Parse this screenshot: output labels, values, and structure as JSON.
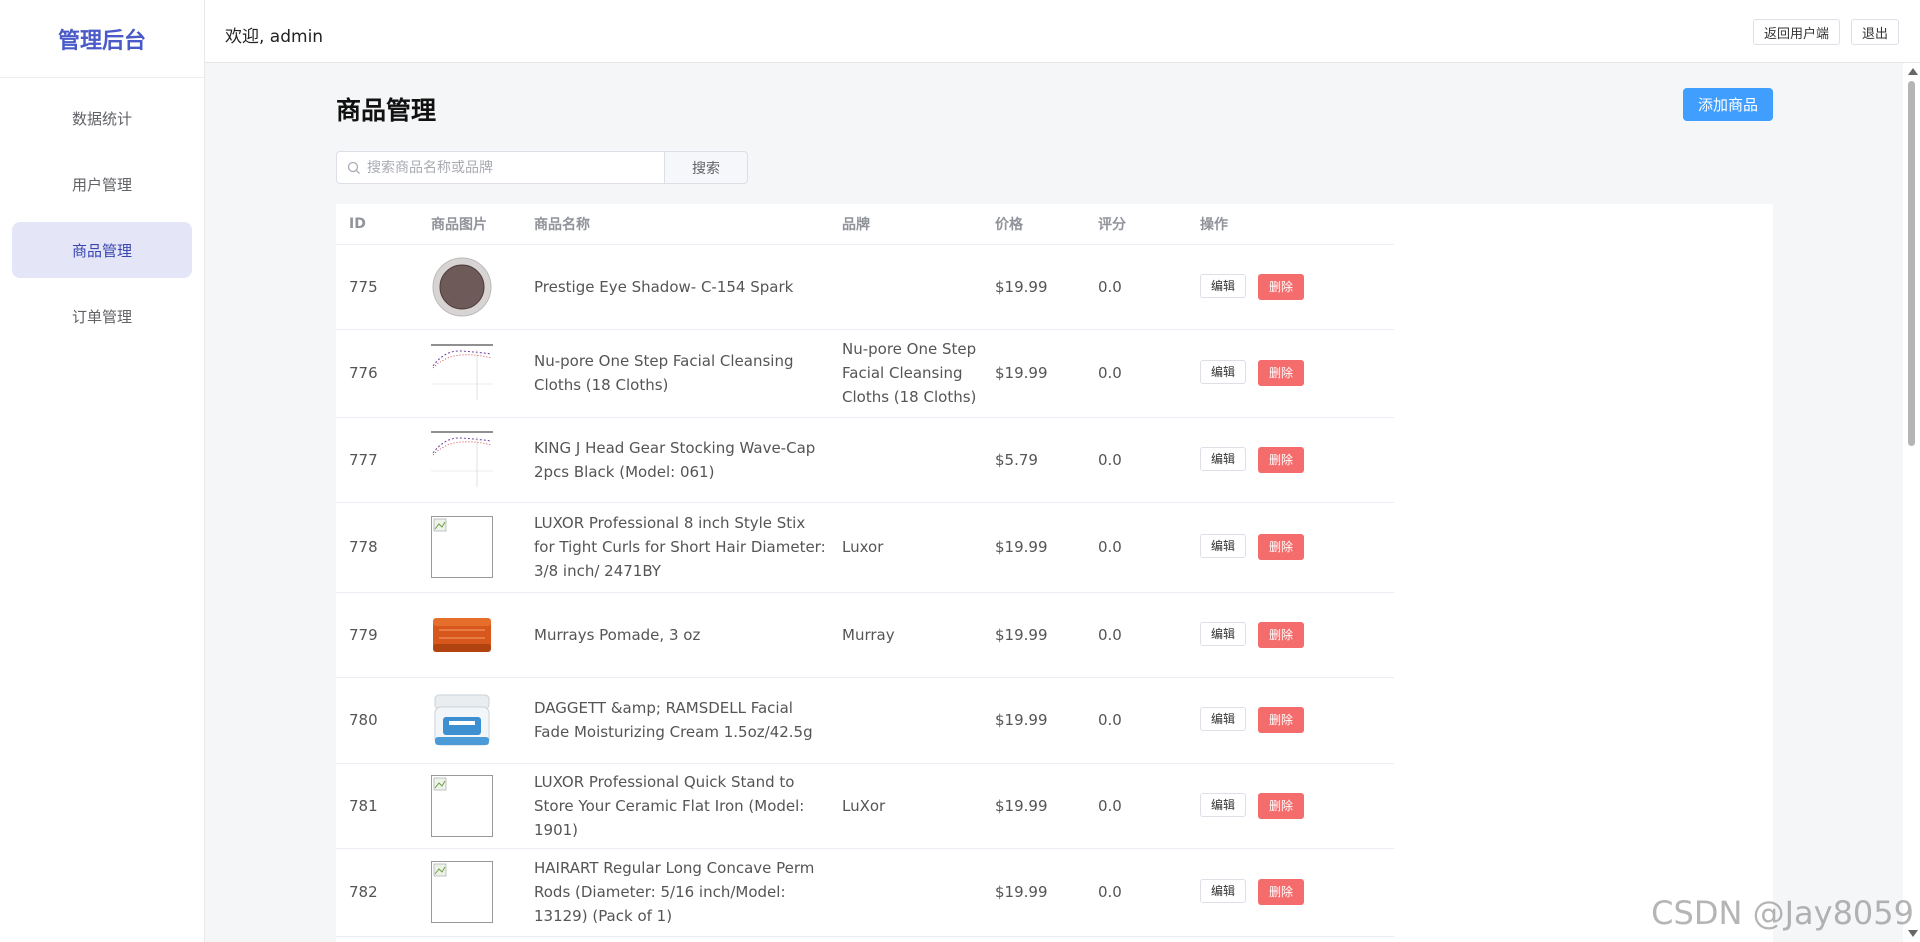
{
  "brand": "管理后台",
  "sidebar": {
    "items": [
      {
        "label": "数据统计"
      },
      {
        "label": "用户管理"
      },
      {
        "label": "商品管理"
      },
      {
        "label": "订单管理"
      }
    ]
  },
  "header": {
    "welcome": "欢迎, admin",
    "back_label": "返回用户端",
    "logout_label": "退出"
  },
  "page": {
    "title": "商品管理",
    "add_label": "添加商品"
  },
  "search": {
    "placeholder": "搜索商品名称或品牌",
    "value": "",
    "button_label": "搜索"
  },
  "table": {
    "columns": [
      "ID",
      "商品图片",
      "商品名称",
      "品牌",
      "价格",
      "评分",
      "操作"
    ],
    "edit_label": "编辑",
    "delete_label": "删除",
    "rows": [
      {
        "id": "775",
        "image": "eyeshadow",
        "name": "Prestige Eye Shadow- C-154 Spark",
        "brand": "",
        "price": "$19.99",
        "rating": "0.0"
      },
      {
        "id": "776",
        "image": "chart",
        "name": "Nu-pore One Step Facial Cleansing Cloths (18 Cloths)",
        "brand": "Nu-pore One Step Facial Cleansing Cloths (18 Cloths)",
        "price": "$19.99",
        "rating": "0.0"
      },
      {
        "id": "777",
        "image": "chart",
        "name": "KING J Head Gear Stocking Wave-Cap 2pcs Black (Model: 061)",
        "brand": "",
        "price": "$5.79",
        "rating": "0.0"
      },
      {
        "id": "778",
        "image": "broken",
        "name": "LUXOR Professional 8 inch Style Stix for Tight Curls for Short Hair Diameter: 3/8 inch/ 2471BY",
        "brand": "Luxor",
        "price": "$19.99",
        "rating": "0.0"
      },
      {
        "id": "779",
        "image": "pomade",
        "name": "Murrays Pomade, 3 oz",
        "brand": "Murray",
        "price": "$19.99",
        "rating": "0.0"
      },
      {
        "id": "780",
        "image": "cream",
        "name": "DAGGETT &amp; RAMSDELL Facial Fade Moisturizing Cream 1.5oz/42.5g",
        "brand": "",
        "price": "$19.99",
        "rating": "0.0"
      },
      {
        "id": "781",
        "image": "broken",
        "name": "LUXOR Professional Quick Stand to Store Your Ceramic Flat Iron (Model: 1901)",
        "brand": "LuXor",
        "price": "$19.99",
        "rating": "0.0"
      },
      {
        "id": "782",
        "image": "broken",
        "name": "HAIRART Regular Long Concave Perm Rods (Diameter: 5/16 inch/Model: 13129) (Pack of 1)",
        "brand": "",
        "price": "$19.99",
        "rating": "0.0"
      }
    ]
  },
  "watermark": "CSDN @Jay8059",
  "colors": {
    "accent": "#409eff",
    "danger": "#f56c6c",
    "brand": "#4a5ac8",
    "nav_active_bg": "#e4e6f8"
  }
}
